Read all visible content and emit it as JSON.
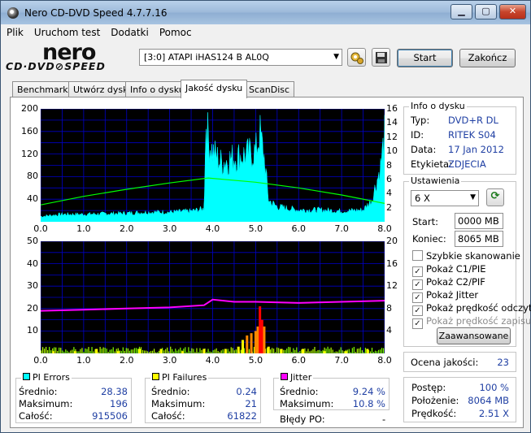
{
  "window": {
    "title": "Nero CD-DVD Speed 4.7.7.16",
    "min_label": "▁",
    "max_label": "▢",
    "close_label": "✕"
  },
  "menu": [
    "Plik",
    "Uruchom test",
    "Dodatki",
    "Pomoc"
  ],
  "logo": {
    "top": "nero",
    "bottom": "CD·DVD⊘SPEED"
  },
  "toolbar": {
    "drive": "[3:0]   ATAPI iHAS124   B AL0Q",
    "start_label": "Start",
    "stop_label": "Zakończ"
  },
  "tabs": [
    "Benchmark",
    "Utwórz dysk",
    "Info o dysku",
    "Jakość dysku",
    "ScanDisc"
  ],
  "active_tab": "Jakość dysku",
  "disc_info": {
    "title": "Info o dysku",
    "rows": [
      {
        "label": "Typ:",
        "value": "DVD+R DL"
      },
      {
        "label": "ID:",
        "value": "RITEK S04"
      },
      {
        "label": "Data:",
        "value": "17 Jan 2012"
      },
      {
        "label": "Etykieta:",
        "value": "ZDJECIA"
      }
    ]
  },
  "settings": {
    "title": "Ustawienia",
    "speed": "6 X",
    "start_label": "Start:",
    "start_value": "0000 MB",
    "end_label": "Koniec:",
    "end_value": "8065 MB",
    "checks": [
      {
        "label": "Szybkie skanowanie",
        "checked": false,
        "disabled": false
      },
      {
        "label": "Pokaż C1/PIE",
        "checked": true,
        "disabled": false
      },
      {
        "label": "Pokaż C2/PIF",
        "checked": true,
        "disabled": false
      },
      {
        "label": "Pokaż Jitter",
        "checked": true,
        "disabled": false
      },
      {
        "label": "Pokaż prędkość odczytu",
        "checked": true,
        "disabled": false
      },
      {
        "label": "Pokaż prędkość zapisu",
        "checked": true,
        "disabled": true
      }
    ],
    "advanced_label": "Zaawansowane"
  },
  "quality": {
    "label": "Ocena jakości:",
    "value": "23"
  },
  "progress": {
    "rows": [
      {
        "label": "Postęp:",
        "value": "100 %"
      },
      {
        "label": "Położenie:",
        "value": "8064 MB"
      },
      {
        "label": "Prędkość:",
        "value": "2.51 X"
      }
    ]
  },
  "pi_errors": {
    "title": "PI Errors",
    "color": "#00ffff",
    "rows": [
      {
        "label": "Średnio:",
        "value": "28.38"
      },
      {
        "label": "Maksimum:",
        "value": "196"
      },
      {
        "label": "Całość:",
        "value": "915506"
      }
    ]
  },
  "pi_failures": {
    "title": "PI Failures",
    "color": "#ffff00",
    "rows": [
      {
        "label": "Średnio:",
        "value": "0.24"
      },
      {
        "label": "Maksimum:",
        "value": "21"
      },
      {
        "label": "Całość:",
        "value": "61822"
      }
    ]
  },
  "jitter": {
    "title": "Jitter",
    "color": "#ff00ff",
    "rows": [
      {
        "label": "Średnio:",
        "value": "9.24 %"
      },
      {
        "label": "Maksimum:",
        "value": "10.8 %"
      }
    ]
  },
  "bledy_po": {
    "label": "Błędy PO:",
    "value": "-"
  },
  "chart_data": [
    {
      "type": "area",
      "x_ticks": [
        "0.0",
        "1.0",
        "2.0",
        "3.0",
        "4.0",
        "5.0",
        "6.0",
        "7.0",
        "8.0"
      ],
      "y_left_ticks": [
        "200",
        "160",
        "120",
        "80",
        "40"
      ],
      "y_right_ticks": [
        "16",
        "14",
        "12",
        "10",
        "8",
        "6",
        "4",
        "2"
      ],
      "xlim": [
        0,
        8
      ],
      "ylim_left": [
        0,
        200
      ],
      "ylim_right": [
        0,
        16
      ],
      "grid": true,
      "series": [
        {
          "color": "#00ffff",
          "x": [
            0,
            0.5,
            1,
            1.5,
            2,
            2.5,
            3,
            3.5,
            3.8,
            3.85,
            3.9,
            4.0,
            4.2,
            4.5,
            4.8,
            5.0,
            5.1,
            5.2,
            5.3,
            5.5,
            6,
            6.5,
            7,
            7.5,
            7.7,
            7.9,
            8
          ],
          "y": [
            10,
            14,
            14,
            15,
            16,
            18,
            18,
            20,
            24,
            200,
            150,
            130,
            110,
            120,
            125,
            130,
            165,
            120,
            40,
            28,
            22,
            22,
            20,
            22,
            40,
            100,
            160
          ]
        },
        {
          "color": "#00ff00",
          "x": [
            0,
            1,
            2,
            3,
            3.9,
            5,
            6,
            7,
            8
          ],
          "y": [
            2.4,
            3.6,
            4.6,
            5.5,
            6.2,
            5.6,
            4.8,
            3.8,
            2.6
          ]
        }
      ]
    },
    {
      "type": "bar",
      "x_ticks": [
        "0.0",
        "1.0",
        "2.0",
        "3.0",
        "4.0",
        "5.0",
        "6.0",
        "7.0",
        "8.0"
      ],
      "y_left_ticks": [
        "50",
        "40",
        "30",
        "20",
        "10"
      ],
      "y_right_ticks": [
        "20",
        "16",
        "12",
        "8",
        "4"
      ],
      "xlim": [
        0,
        8
      ],
      "ylim_left": [
        0,
        50
      ],
      "ylim_right": [
        0,
        20
      ],
      "grid": true,
      "series": [
        {
          "color": "#ffff00",
          "x": [
            0.3,
            0.8,
            1.3,
            1.8,
            2.3,
            2.8,
            3.3,
            3.8,
            4.3,
            4.6,
            4.7,
            4.8,
            4.9,
            5.0,
            5.05,
            5.1,
            5.15,
            5.2,
            5.3,
            5.6,
            6.1,
            6.6,
            7.1,
            7.6
          ],
          "y": [
            1,
            1,
            2,
            1,
            2,
            2,
            1,
            2,
            2,
            3,
            6,
            8,
            9,
            10,
            12,
            21,
            15,
            12,
            3,
            2,
            2,
            1,
            1,
            2
          ]
        },
        {
          "color": "#ff00ff",
          "x": [
            0,
            1,
            2,
            3,
            3.8,
            4.0,
            4.5,
            5,
            6,
            7,
            8
          ],
          "y": [
            7.6,
            7.8,
            8.0,
            8.2,
            8.6,
            9.6,
            9.2,
            9.2,
            9.0,
            9.2,
            9.4
          ]
        }
      ]
    }
  ]
}
